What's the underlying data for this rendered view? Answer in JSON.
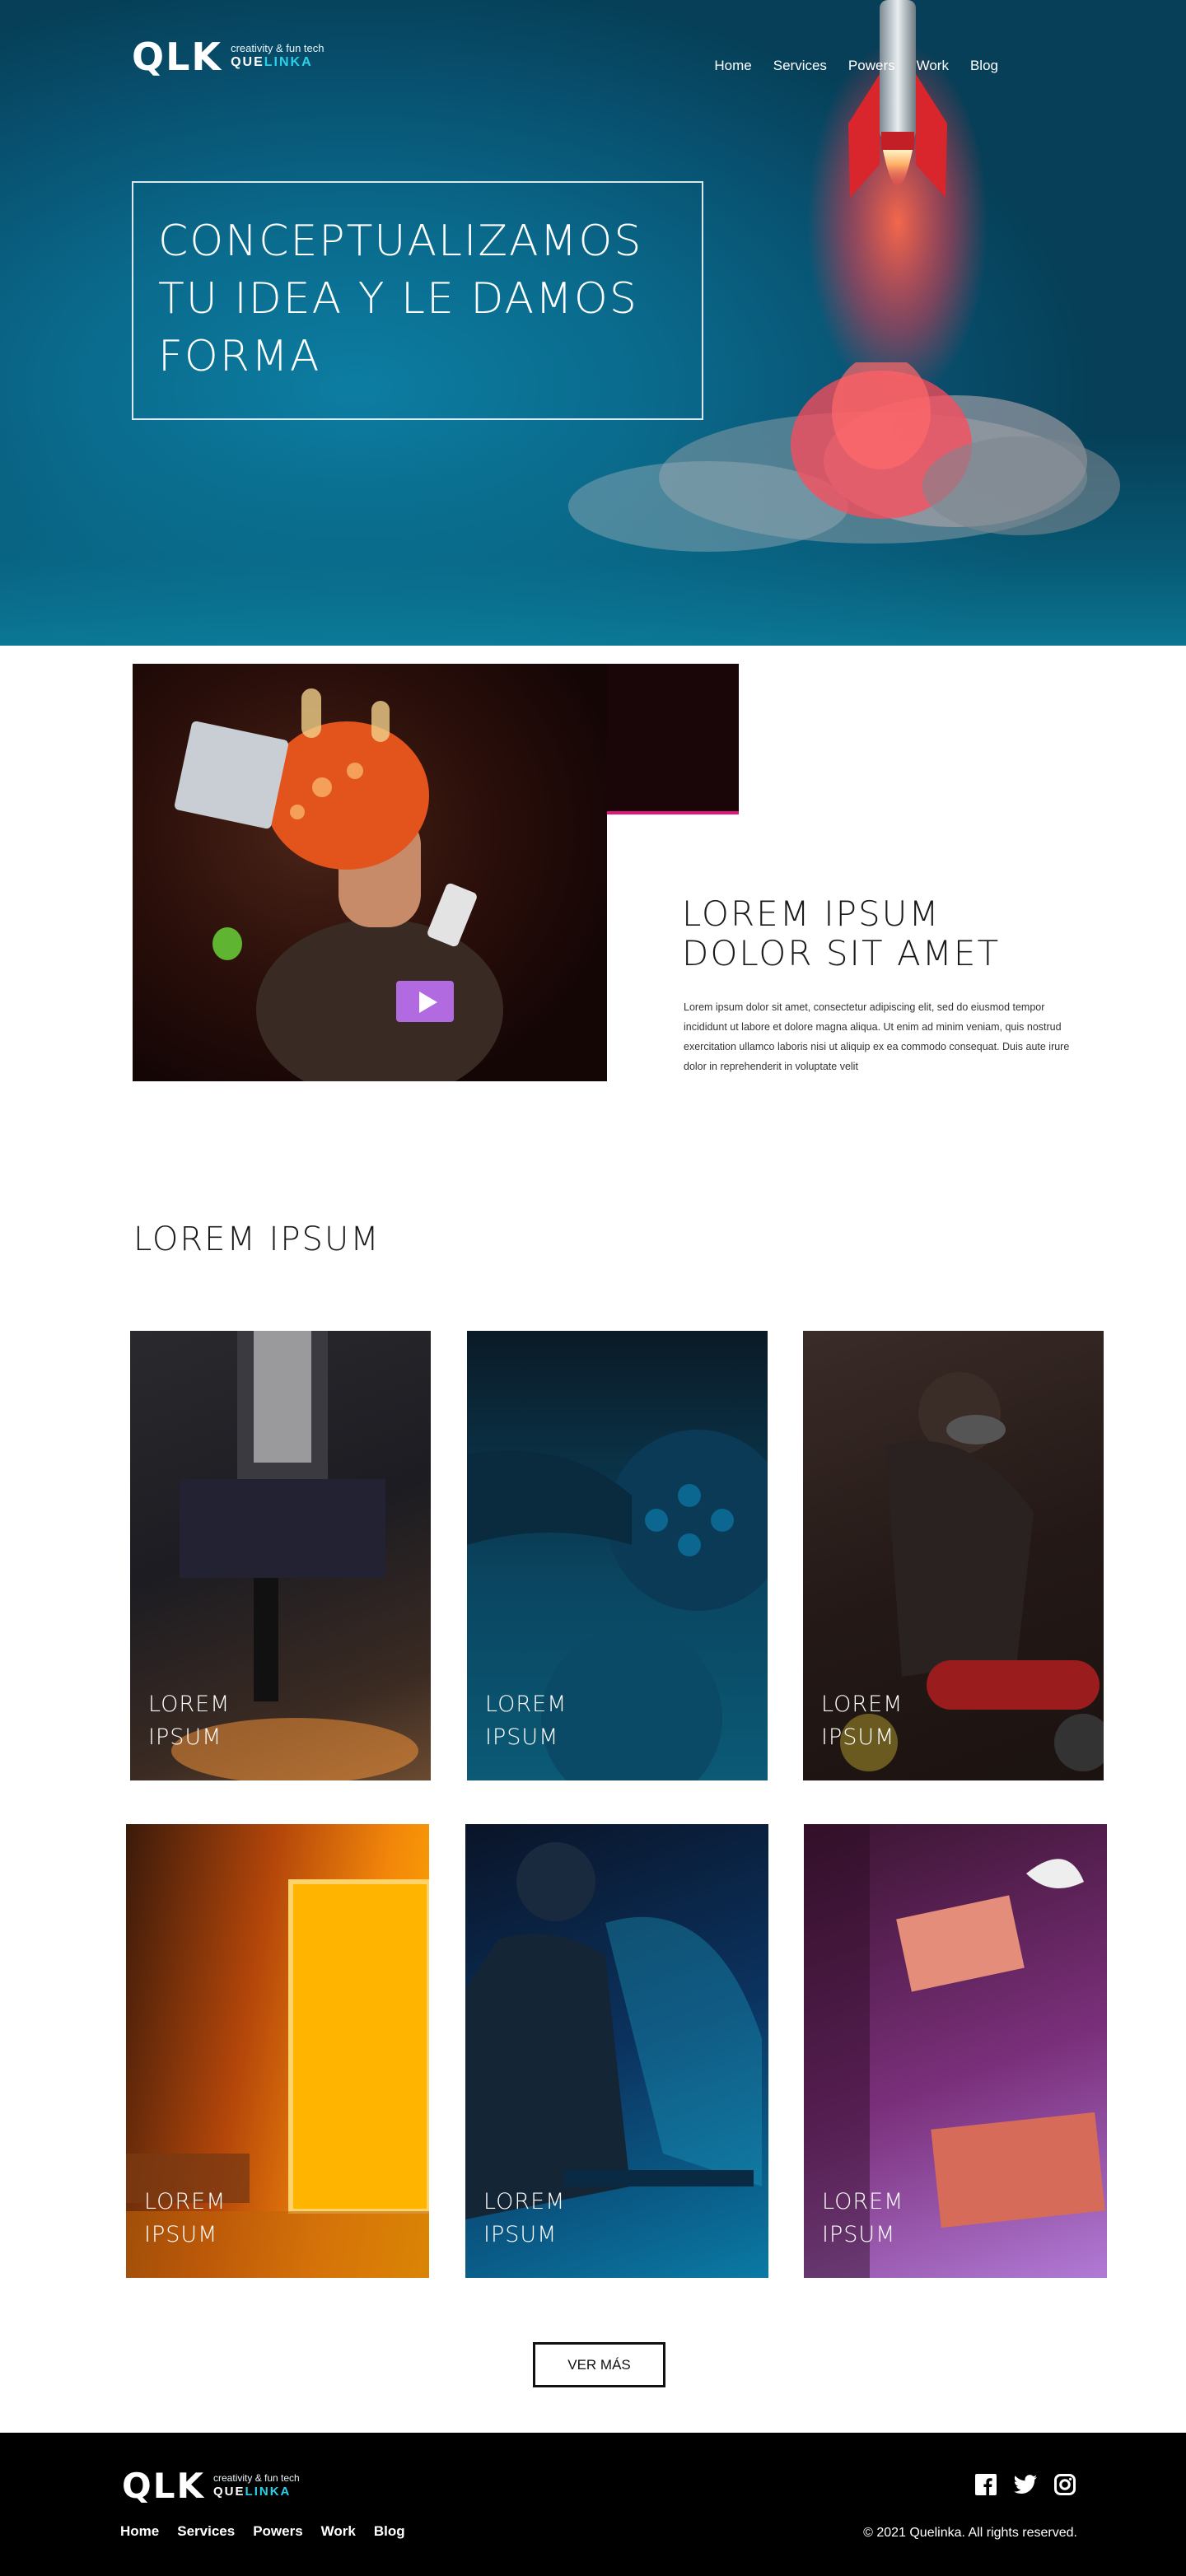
{
  "header": {
    "logo_mark": "QLK",
    "logo_tagline": "creativity & fun tech",
    "logo_brand_a": "QUE",
    "logo_brand_b": "LINKA",
    "nav": [
      "Home",
      "Services",
      "Powers",
      "Work",
      "Blog"
    ]
  },
  "hero": {
    "title": "CONCEPTUALIZAMOS TU IDEA Y LE DAMOS FORMA"
  },
  "feature": {
    "title": "LOREM IPSUM DOLOR SIT AMET",
    "body": "Lorem ipsum dolor sit amet, consectetur adipiscing elit, sed do eiusmod tempor incididunt ut labore et dolore magna aliqua. Ut enim ad minim veniam, quis nostrud exercitation ullamco laboris nisi ut aliquip ex ea commodo consequat. Duis aute irure dolor in reprehenderit in voluptate velit"
  },
  "gallery": {
    "title": "LOREM IPSUM",
    "cards": [
      {
        "label": "LOREM IPSUM"
      },
      {
        "label": "LOREM IPSUM"
      },
      {
        "label": "LOREM IPSUM"
      },
      {
        "label": "LOREM IPSUM"
      },
      {
        "label": "LOREM IPSUM"
      },
      {
        "label": "LOREM IPSUM"
      }
    ],
    "more_button": "VER MÁS"
  },
  "footer": {
    "logo_mark": "QLK",
    "logo_tagline": "creativity & fun tech",
    "logo_brand_a": "QUE",
    "logo_brand_b": "LINKA",
    "nav": [
      "Home",
      "Services",
      "Powers",
      "Work",
      "Blog"
    ],
    "social": [
      "facebook-icon",
      "twitter-icon",
      "instagram-icon"
    ],
    "copyright": "© 2021 Quelinka. All rights reserved."
  },
  "colors": {
    "hero_bg": "#0a6a8c",
    "accent_cyan": "#2ad1ea",
    "accent_magenta": "#e0177c",
    "footer_bg": "#000000"
  }
}
